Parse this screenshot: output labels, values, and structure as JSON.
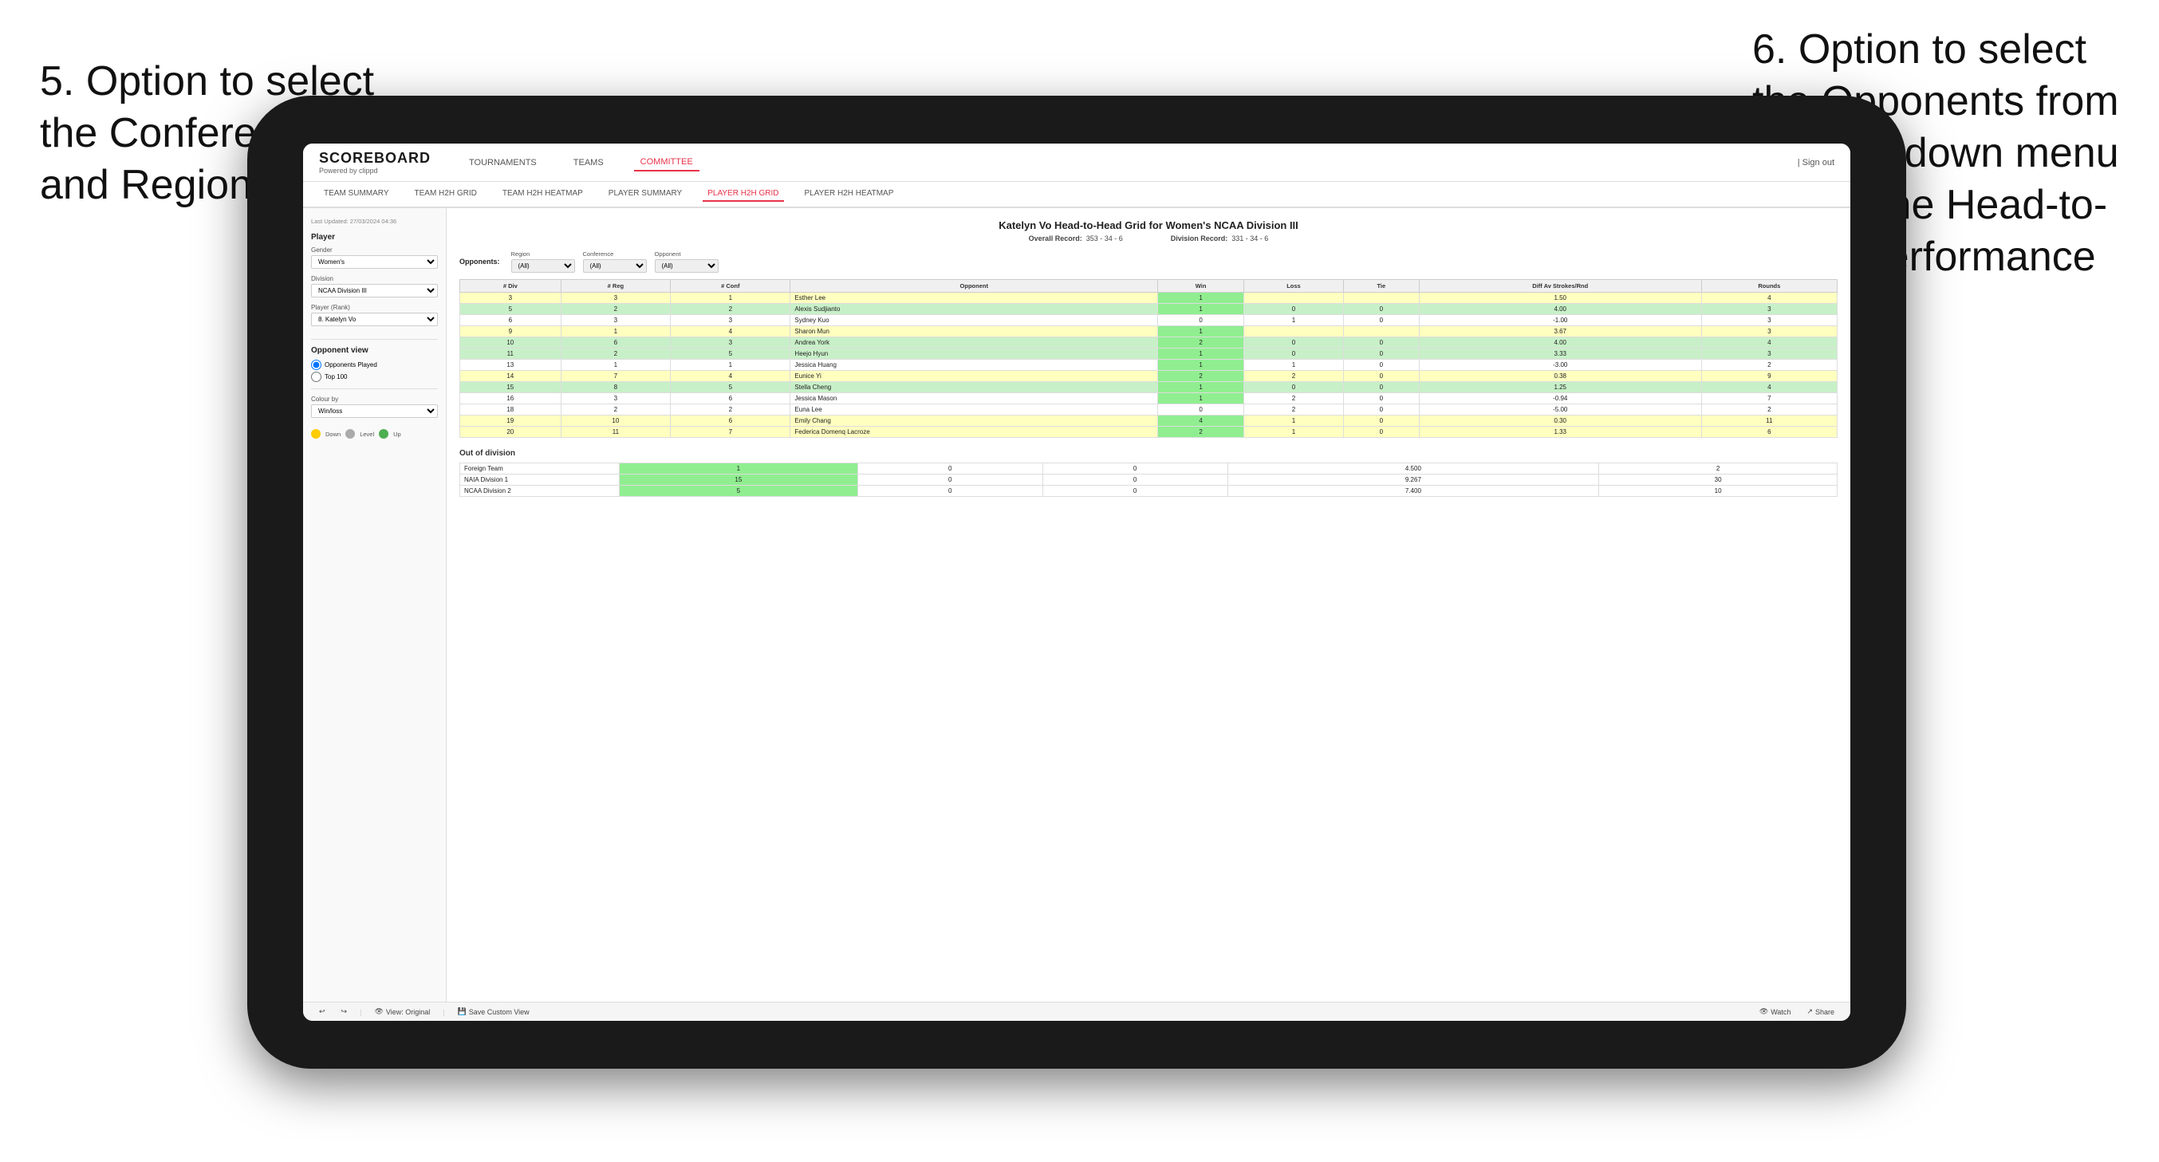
{
  "annotations": {
    "left": "5. Option to select the Conference and Region",
    "right": "6. Option to select the Opponents from the dropdown menu to see the Head-to-Head performance"
  },
  "nav": {
    "logo": "SCOREBOARD",
    "logo_sub": "Powered by clippd",
    "items": [
      "TOURNAMENTS",
      "TEAMS",
      "COMMITTEE"
    ],
    "active_item": "COMMITTEE",
    "right_links": "| Sign out"
  },
  "sub_nav": {
    "items": [
      "TEAM SUMMARY",
      "TEAM H2H GRID",
      "TEAM H2H HEATMAP",
      "PLAYER SUMMARY",
      "PLAYER H2H GRID",
      "PLAYER H2H HEATMAP"
    ],
    "active": "PLAYER H2H GRID"
  },
  "sidebar": {
    "last_updated": "Last Updated: 27/03/2024 04:36",
    "player_section": "Player",
    "gender_label": "Gender",
    "gender_value": "Women's",
    "division_label": "Division",
    "division_value": "NCAA Division III",
    "player_rank_label": "Player (Rank)",
    "player_rank_value": "8. Katelyn Vo",
    "opponent_view_label": "Opponent view",
    "opponent_options": [
      "Opponents Played",
      "Top 100"
    ],
    "opponent_selected": "Opponents Played",
    "colour_by_label": "Colour by",
    "colour_by_value": "Win/loss",
    "legend_down": "Down",
    "legend_level": "Level",
    "legend_up": "Up"
  },
  "grid": {
    "title": "Katelyn Vo Head-to-Head Grid for Women's NCAA Division III",
    "overall_record_label": "Overall Record:",
    "overall_record": "353 - 34 - 6",
    "division_record_label": "Division Record:",
    "division_record": "331 - 34 - 6",
    "filters": {
      "opponents_label": "Opponents:",
      "region_label": "Region",
      "region_value": "(All)",
      "conference_label": "Conference",
      "conference_value": "(All)",
      "opponent_label": "Opponent",
      "opponent_value": "(All)"
    },
    "table_headers": [
      "# Div",
      "# Reg",
      "# Conf",
      "Opponent",
      "Win",
      "Loss",
      "Tie",
      "Diff Av Strokes/Rnd",
      "Rounds"
    ],
    "rows": [
      {
        "div": "3",
        "reg": "3",
        "conf": "1",
        "opponent": "Esther Lee",
        "win": "1",
        "loss": "",
        "tie": "",
        "diff": "1.50",
        "rounds": "4",
        "style": "yellow"
      },
      {
        "div": "5",
        "reg": "2",
        "conf": "2",
        "opponent": "Alexis Sudjianto",
        "win": "1",
        "loss": "0",
        "tie": "0",
        "diff": "4.00",
        "rounds": "3",
        "style": "green"
      },
      {
        "div": "6",
        "reg": "3",
        "conf": "3",
        "opponent": "Sydney Kuo",
        "win": "0",
        "loss": "1",
        "tie": "0",
        "diff": "-1.00",
        "rounds": "3",
        "style": "loss"
      },
      {
        "div": "9",
        "reg": "1",
        "conf": "4",
        "opponent": "Sharon Mun",
        "win": "1",
        "loss": "",
        "tie": "",
        "diff": "3.67",
        "rounds": "3",
        "style": "yellow"
      },
      {
        "div": "10",
        "reg": "6",
        "conf": "3",
        "opponent": "Andrea York",
        "win": "2",
        "loss": "0",
        "tie": "0",
        "diff": "4.00",
        "rounds": "4",
        "style": "green"
      },
      {
        "div": "11",
        "reg": "2",
        "conf": "5",
        "opponent": "Heejo Hyun",
        "win": "1",
        "loss": "0",
        "tie": "0",
        "diff": "3.33",
        "rounds": "3",
        "style": "green"
      },
      {
        "div": "13",
        "reg": "1",
        "conf": "1",
        "opponent": "Jessica Huang",
        "win": "1",
        "loss": "1",
        "tie": "0",
        "diff": "-3.00",
        "rounds": "2",
        "style": "loss"
      },
      {
        "div": "14",
        "reg": "7",
        "conf": "4",
        "opponent": "Eunice Yi",
        "win": "2",
        "loss": "2",
        "tie": "0",
        "diff": "0.38",
        "rounds": "9",
        "style": "yellow"
      },
      {
        "div": "15",
        "reg": "8",
        "conf": "5",
        "opponent": "Stella Cheng",
        "win": "1",
        "loss": "0",
        "tie": "0",
        "diff": "1.25",
        "rounds": "4",
        "style": "green"
      },
      {
        "div": "16",
        "reg": "3",
        "conf": "6",
        "opponent": "Jessica Mason",
        "win": "1",
        "loss": "2",
        "tie": "0",
        "diff": "-0.94",
        "rounds": "7",
        "style": "loss"
      },
      {
        "div": "18",
        "reg": "2",
        "conf": "2",
        "opponent": "Euna Lee",
        "win": "0",
        "loss": "2",
        "tie": "0",
        "diff": "-5.00",
        "rounds": "2",
        "style": "loss"
      },
      {
        "div": "19",
        "reg": "10",
        "conf": "6",
        "opponent": "Emily Chang",
        "win": "4",
        "loss": "1",
        "tie": "0",
        "diff": "0.30",
        "rounds": "11",
        "style": "yellow"
      },
      {
        "div": "20",
        "reg": "11",
        "conf": "7",
        "opponent": "Federica Domenq Lacroze",
        "win": "2",
        "loss": "1",
        "tie": "0",
        "diff": "1.33",
        "rounds": "6",
        "style": "yellow"
      }
    ],
    "out_of_division_label": "Out of division",
    "out_of_division_rows": [
      {
        "label": "Foreign Team",
        "win": "1",
        "loss": "0",
        "tie": "0",
        "diff": "4.500",
        "rounds": "2"
      },
      {
        "label": "NAIA Division 1",
        "win": "15",
        "loss": "0",
        "tie": "0",
        "diff": "9.267",
        "rounds": "30"
      },
      {
        "label": "NCAA Division 2",
        "win": "5",
        "loss": "0",
        "tie": "0",
        "diff": "7.400",
        "rounds": "10"
      }
    ]
  },
  "toolbar": {
    "view_original": "View: Original",
    "save_custom": "Save Custom View",
    "watch": "Watch",
    "share": "Share"
  }
}
